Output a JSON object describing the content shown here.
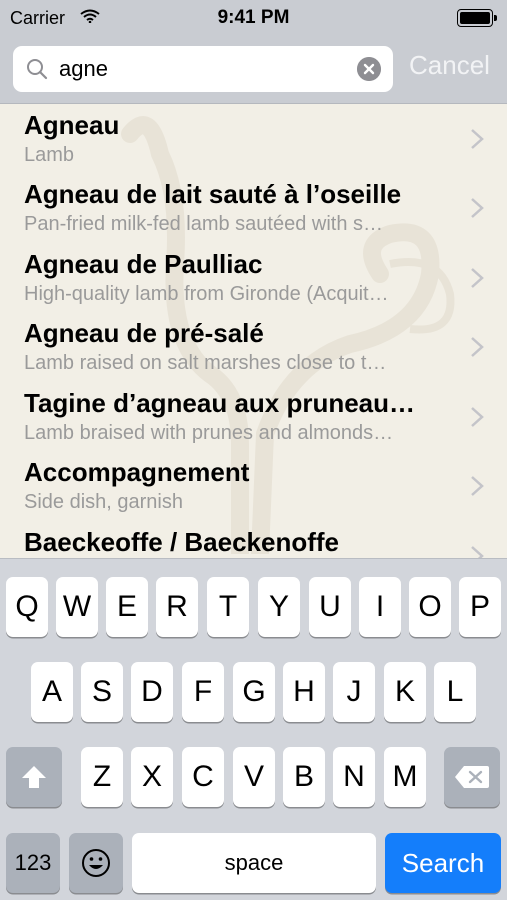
{
  "status_bar": {
    "carrier": "Carrier",
    "time": "9:41 PM"
  },
  "search": {
    "query": "agne",
    "cancel_label": "Cancel"
  },
  "results": [
    {
      "title": "Agneau",
      "subtitle": "Lamb"
    },
    {
      "title": "Agneau de lait sauté à l’oseille",
      "subtitle": "Pan-fried milk-fed lamb sautéed with s…"
    },
    {
      "title": "Agneau de Paulliac",
      "subtitle": "High-quality lamb from Gironde (Acquit…"
    },
    {
      "title": "Agneau de pré-salé",
      "subtitle": "Lamb raised on salt marshes close to t…"
    },
    {
      "title": "Tagine d’agneau aux pruneau…",
      "subtitle": "Lamb braised with prunes and almonds…"
    },
    {
      "title": "Accompagnement",
      "subtitle": "Side dish, garnish"
    },
    {
      "title": "Baeckeoffe / Baeckenoffe",
      "subtitle": ""
    }
  ],
  "keyboard": {
    "row1": [
      "Q",
      "W",
      "E",
      "R",
      "T",
      "Y",
      "U",
      "I",
      "O",
      "P"
    ],
    "row2": [
      "A",
      "S",
      "D",
      "F",
      "G",
      "H",
      "J",
      "K",
      "L"
    ],
    "row3": [
      "Z",
      "X",
      "C",
      "V",
      "B",
      "N",
      "M"
    ],
    "numbers_label": "123",
    "space_label": "space",
    "search_label": "Search"
  },
  "colors": {
    "accent": "#147efb",
    "list_background": "#f2efe6",
    "keyboard_background": "#d2d5db"
  }
}
